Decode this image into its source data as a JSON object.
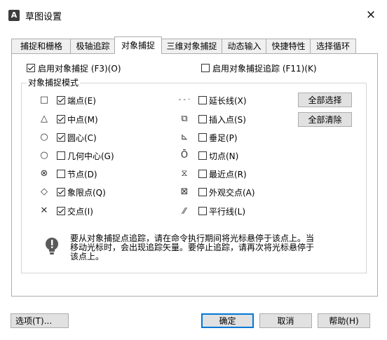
{
  "window": {
    "title": "草图设置",
    "app_icon_letter": "A",
    "close_symbol": "×"
  },
  "tabs": [
    {
      "label": "捕捉和栅格",
      "active": false
    },
    {
      "label": "极轴追踪",
      "active": false
    },
    {
      "label": "对象捕捉",
      "active": true
    },
    {
      "label": "三维对象捕捉",
      "active": false
    },
    {
      "label": "动态输入",
      "active": false
    },
    {
      "label": "快捷特性",
      "active": false
    },
    {
      "label": "选择循环",
      "active": false
    }
  ],
  "osnap_on": {
    "label": "启用对象捕捉 (F3)(O)",
    "checked": true
  },
  "otrack_on": {
    "label": "启用对象捕捉追踪 (F11)(K)",
    "checked": false
  },
  "group_title": "对象捕捉模式",
  "left_modes": [
    {
      "symbol_icon": "square-icon",
      "glyph": "□",
      "label": "端点(E)",
      "checked": true
    },
    {
      "symbol_icon": "triangle-icon",
      "glyph": "△",
      "label": "中点(M)",
      "checked": true
    },
    {
      "symbol_icon": "circle-icon",
      "glyph": "○",
      "label": "圆心(C)",
      "checked": true
    },
    {
      "symbol_icon": "circle-icon",
      "glyph": "○",
      "label": "几何中心(G)",
      "checked": false
    },
    {
      "symbol_icon": "node-icon",
      "glyph": "⊗",
      "label": "节点(D)",
      "checked": false
    },
    {
      "symbol_icon": "diamond-icon",
      "glyph": "◇",
      "label": "象限点(Q)",
      "checked": true
    },
    {
      "symbol_icon": "cross-icon",
      "glyph": "✕",
      "label": "交点(I)",
      "checked": true
    }
  ],
  "right_modes": [
    {
      "symbol_icon": "extension-icon",
      "glyph": "- - ·",
      "label": "延长线(X)",
      "checked": false
    },
    {
      "symbol_icon": "insertion-icon",
      "glyph": "⧉",
      "label": "插入点(S)",
      "checked": false
    },
    {
      "symbol_icon": "perpendicular-icon",
      "glyph": "⊾",
      "label": "垂足(P)",
      "checked": false
    },
    {
      "symbol_icon": "tangent-icon",
      "glyph": "Ō",
      "label": "切点(N)",
      "checked": false
    },
    {
      "symbol_icon": "nearest-icon",
      "glyph": "⧖",
      "label": "最近点(R)",
      "checked": false
    },
    {
      "symbol_icon": "apparent-intersection-icon",
      "glyph": "⊠",
      "label": "外观交点(A)",
      "checked": false
    },
    {
      "symbol_icon": "parallel-icon",
      "glyph": "⁄⁄",
      "label": "平行线(L)",
      "checked": false
    }
  ],
  "buttons": {
    "select_all": "全部选择",
    "clear_all": "全部清除",
    "options": "选项(T)...",
    "ok": "确定",
    "cancel": "取消",
    "help": "帮助(H)"
  },
  "tip": {
    "line1": "要从对象捕捉点追踪，请在命令执行期间将光标悬停于该点上。当",
    "line2": "移动光标时，会出现追踪矢量。要停止追踪，请再次将光标悬停于",
    "line3": "该点上。"
  }
}
